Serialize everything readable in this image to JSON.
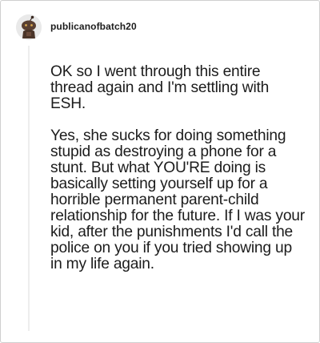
{
  "comment": {
    "author": {
      "username": "publicanofbatch20",
      "avatar_icon": "reddit-snoo-avatar-icon"
    },
    "paragraphs": [
      "OK so I went through this entire thread again and I'm settling with ESH.",
      "Yes, she sucks for doing something stupid as destroying a phone for a stunt. But what YOU'RE doing is basically setting yourself up for a horrible permanent parent-child relationship for the future. If I was your kid, after the punishments I'd call the police on you if you tried showing up in my life again."
    ]
  },
  "colors": {
    "text": "#1c1c1c",
    "border": "#cfcfcf",
    "thread_line": "#ededed",
    "background": "#ffffff"
  }
}
